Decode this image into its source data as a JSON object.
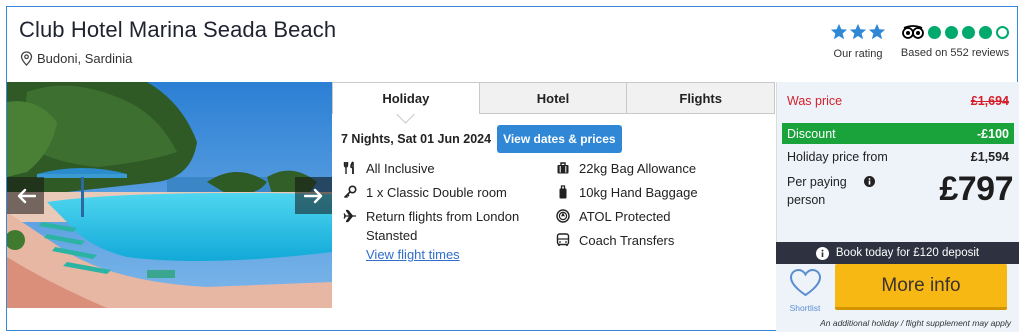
{
  "hotel": {
    "name": "Club Hotel Marina Seada Beach",
    "location": "Budoni, Sardinia"
  },
  "ratings": {
    "our_rating_stars": 3,
    "our_rating_label": "Our rating",
    "tripadvisor_bubbles": 4,
    "tripadvisor_max": 5,
    "reviews_label": "Based on 552 reviews"
  },
  "tabs": [
    {
      "label": "Holiday",
      "active": true
    },
    {
      "label": "Hotel",
      "active": false
    },
    {
      "label": "Flights",
      "active": false
    }
  ],
  "trip": {
    "dates_text": "7 Nights, Sat 01 Jun 2024",
    "dates_button": "View dates & prices"
  },
  "features": {
    "board": "All Inclusive",
    "room": "1 x Classic Double room",
    "flights": "Return flights from London Stansted",
    "flight_link": "View flight times",
    "bag": "22kg Bag Allowance",
    "hand_baggage": "10kg Hand Baggage",
    "atol": "ATOL Protected",
    "transfers": "Coach Transfers"
  },
  "price": {
    "was_label": "Was price",
    "was_value": "£1,694",
    "discount_label": "Discount",
    "discount_value": "-£100",
    "from_label": "Holiday price from",
    "from_value": "£1,594",
    "per_paying_label": "Per paying person",
    "per_person_value": "£797",
    "deposit_text": "Book today for £120 deposit"
  },
  "actions": {
    "shortlist_label": "Shortlist",
    "more_info_label": "More info",
    "supplement_note": "An additional holiday / flight supplement may apply"
  },
  "colors": {
    "border": "#3a88d4",
    "star": "#2f87d6",
    "tripadvisor_green": "#00aa6c",
    "was_price_red": "#d4202a",
    "discount_green": "#19a33a",
    "deposit_dark": "#2d3140",
    "more_info_yellow": "#f8b814"
  }
}
